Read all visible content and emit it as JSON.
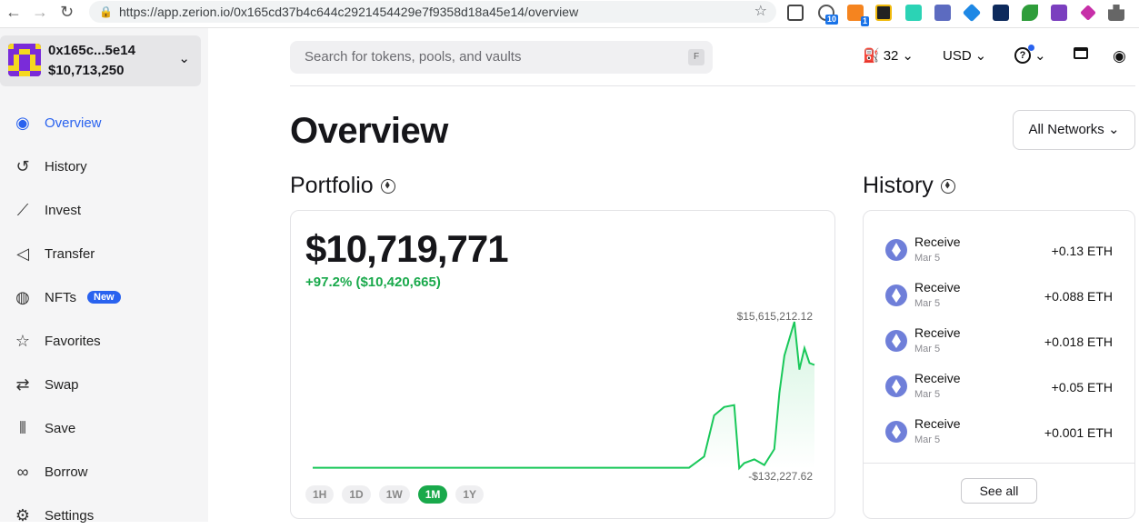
{
  "browser": {
    "url": "https://app.zerion.io/0x165cd37b4c644c2921454429e7f9358d18a45e14/overview",
    "nav_back": "←",
    "nav_forward": "→",
    "nav_reload": "↻",
    "extension_badges": [
      "10",
      "1"
    ]
  },
  "account": {
    "address": "0x165c...5e14",
    "balance": "$10,713,250"
  },
  "sidebar": {
    "items": [
      {
        "label": "Overview",
        "icon": "eye-icon",
        "active": true
      },
      {
        "label": "History",
        "icon": "history-icon"
      },
      {
        "label": "Invest",
        "icon": "chart-icon"
      },
      {
        "label": "Transfer",
        "icon": "send-icon"
      },
      {
        "label": "NFTs",
        "icon": "palette-icon",
        "badge": "New"
      },
      {
        "label": "Favorites",
        "icon": "star-icon"
      },
      {
        "label": "Swap",
        "icon": "swap-icon"
      },
      {
        "label": "Save",
        "icon": "bars-icon"
      },
      {
        "label": "Borrow",
        "icon": "borrow-icon"
      },
      {
        "label": "Settings",
        "icon": "gear-icon"
      }
    ]
  },
  "search": {
    "placeholder": "Search for tokens, pools, and vaults",
    "shortcut": "F"
  },
  "header": {
    "gas": "32",
    "currency": "USD"
  },
  "page": {
    "title": "Overview",
    "network_filter": "All Networks"
  },
  "portfolio": {
    "title": "Portfolio",
    "value": "$10,719,771",
    "change": "+97.2% ($10,420,665)",
    "ranges": [
      "1H",
      "1D",
      "1W",
      "1M",
      "1Y"
    ],
    "active_range": "1M"
  },
  "chart_data": {
    "type": "area",
    "max_label": "$15,615,212.12",
    "min_label": "-$132,227.62",
    "ylim": [
      -132227.62,
      15615212.12
    ],
    "x": [
      0,
      10,
      20,
      30,
      40,
      50,
      60,
      70,
      75,
      78,
      80,
      82,
      84,
      85,
      86,
      88,
      90,
      92,
      93,
      94,
      96,
      97,
      98,
      99,
      100
    ],
    "values": [
      0,
      0,
      0,
      0,
      0,
      0,
      0,
      0,
      0,
      1200000,
      5600000,
      6500000,
      6700000,
      -50000,
      500000,
      900000,
      300000,
      2000000,
      8000000,
      12000000,
      15615212,
      10500000,
      12800000,
      11200000,
      11000000
    ],
    "color": "#19c85a"
  },
  "history": {
    "title": "History",
    "items": [
      {
        "type": "Receive",
        "date": "Mar 5",
        "amount": "+0.13 ETH"
      },
      {
        "type": "Receive",
        "date": "Mar 5",
        "amount": "+0.088 ETH"
      },
      {
        "type": "Receive",
        "date": "Mar 5",
        "amount": "+0.018 ETH"
      },
      {
        "type": "Receive",
        "date": "Mar 5",
        "amount": "+0.05 ETH"
      },
      {
        "type": "Receive",
        "date": "Mar 5",
        "amount": "+0.001 ETH"
      }
    ],
    "see_all": "See all"
  }
}
